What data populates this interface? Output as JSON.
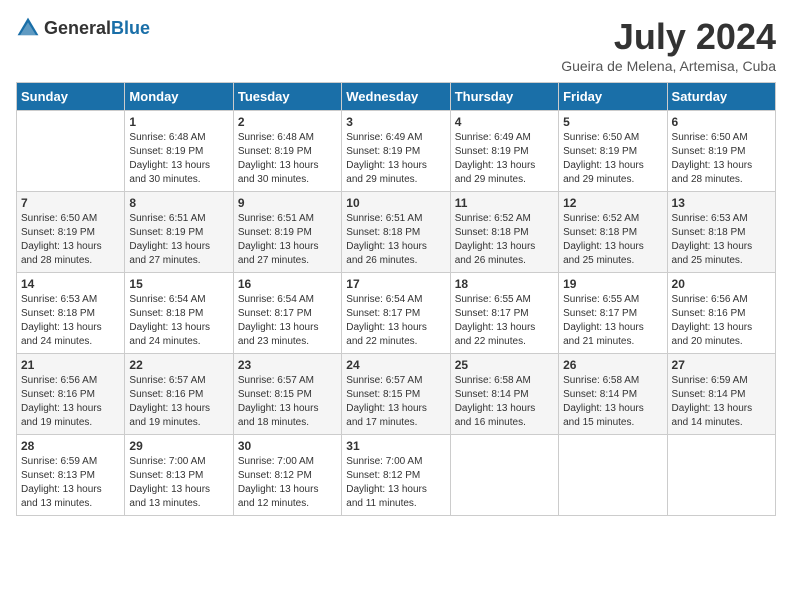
{
  "header": {
    "logo_general": "General",
    "logo_blue": "Blue",
    "month": "July 2024",
    "location": "Gueira de Melena, Artemisa, Cuba"
  },
  "weekdays": [
    "Sunday",
    "Monday",
    "Tuesday",
    "Wednesday",
    "Thursday",
    "Friday",
    "Saturday"
  ],
  "weeks": [
    [
      {
        "day": "",
        "sunrise": "",
        "sunset": "",
        "daylight": ""
      },
      {
        "day": "1",
        "sunrise": "Sunrise: 6:48 AM",
        "sunset": "Sunset: 8:19 PM",
        "daylight": "Daylight: 13 hours and 30 minutes."
      },
      {
        "day": "2",
        "sunrise": "Sunrise: 6:48 AM",
        "sunset": "Sunset: 8:19 PM",
        "daylight": "Daylight: 13 hours and 30 minutes."
      },
      {
        "day": "3",
        "sunrise": "Sunrise: 6:49 AM",
        "sunset": "Sunset: 8:19 PM",
        "daylight": "Daylight: 13 hours and 29 minutes."
      },
      {
        "day": "4",
        "sunrise": "Sunrise: 6:49 AM",
        "sunset": "Sunset: 8:19 PM",
        "daylight": "Daylight: 13 hours and 29 minutes."
      },
      {
        "day": "5",
        "sunrise": "Sunrise: 6:50 AM",
        "sunset": "Sunset: 8:19 PM",
        "daylight": "Daylight: 13 hours and 29 minutes."
      },
      {
        "day": "6",
        "sunrise": "Sunrise: 6:50 AM",
        "sunset": "Sunset: 8:19 PM",
        "daylight": "Daylight: 13 hours and 28 minutes."
      }
    ],
    [
      {
        "day": "7",
        "sunrise": "Sunrise: 6:50 AM",
        "sunset": "Sunset: 8:19 PM",
        "daylight": "Daylight: 13 hours and 28 minutes."
      },
      {
        "day": "8",
        "sunrise": "Sunrise: 6:51 AM",
        "sunset": "Sunset: 8:19 PM",
        "daylight": "Daylight: 13 hours and 27 minutes."
      },
      {
        "day": "9",
        "sunrise": "Sunrise: 6:51 AM",
        "sunset": "Sunset: 8:19 PM",
        "daylight": "Daylight: 13 hours and 27 minutes."
      },
      {
        "day": "10",
        "sunrise": "Sunrise: 6:51 AM",
        "sunset": "Sunset: 8:18 PM",
        "daylight": "Daylight: 13 hours and 26 minutes."
      },
      {
        "day": "11",
        "sunrise": "Sunrise: 6:52 AM",
        "sunset": "Sunset: 8:18 PM",
        "daylight": "Daylight: 13 hours and 26 minutes."
      },
      {
        "day": "12",
        "sunrise": "Sunrise: 6:52 AM",
        "sunset": "Sunset: 8:18 PM",
        "daylight": "Daylight: 13 hours and 25 minutes."
      },
      {
        "day": "13",
        "sunrise": "Sunrise: 6:53 AM",
        "sunset": "Sunset: 8:18 PM",
        "daylight": "Daylight: 13 hours and 25 minutes."
      }
    ],
    [
      {
        "day": "14",
        "sunrise": "Sunrise: 6:53 AM",
        "sunset": "Sunset: 8:18 PM",
        "daylight": "Daylight: 13 hours and 24 minutes."
      },
      {
        "day": "15",
        "sunrise": "Sunrise: 6:54 AM",
        "sunset": "Sunset: 8:18 PM",
        "daylight": "Daylight: 13 hours and 24 minutes."
      },
      {
        "day": "16",
        "sunrise": "Sunrise: 6:54 AM",
        "sunset": "Sunset: 8:17 PM",
        "daylight": "Daylight: 13 hours and 23 minutes."
      },
      {
        "day": "17",
        "sunrise": "Sunrise: 6:54 AM",
        "sunset": "Sunset: 8:17 PM",
        "daylight": "Daylight: 13 hours and 22 minutes."
      },
      {
        "day": "18",
        "sunrise": "Sunrise: 6:55 AM",
        "sunset": "Sunset: 8:17 PM",
        "daylight": "Daylight: 13 hours and 22 minutes."
      },
      {
        "day": "19",
        "sunrise": "Sunrise: 6:55 AM",
        "sunset": "Sunset: 8:17 PM",
        "daylight": "Daylight: 13 hours and 21 minutes."
      },
      {
        "day": "20",
        "sunrise": "Sunrise: 6:56 AM",
        "sunset": "Sunset: 8:16 PM",
        "daylight": "Daylight: 13 hours and 20 minutes."
      }
    ],
    [
      {
        "day": "21",
        "sunrise": "Sunrise: 6:56 AM",
        "sunset": "Sunset: 8:16 PM",
        "daylight": "Daylight: 13 hours and 19 minutes."
      },
      {
        "day": "22",
        "sunrise": "Sunrise: 6:57 AM",
        "sunset": "Sunset: 8:16 PM",
        "daylight": "Daylight: 13 hours and 19 minutes."
      },
      {
        "day": "23",
        "sunrise": "Sunrise: 6:57 AM",
        "sunset": "Sunset: 8:15 PM",
        "daylight": "Daylight: 13 hours and 18 minutes."
      },
      {
        "day": "24",
        "sunrise": "Sunrise: 6:57 AM",
        "sunset": "Sunset: 8:15 PM",
        "daylight": "Daylight: 13 hours and 17 minutes."
      },
      {
        "day": "25",
        "sunrise": "Sunrise: 6:58 AM",
        "sunset": "Sunset: 8:14 PM",
        "daylight": "Daylight: 13 hours and 16 minutes."
      },
      {
        "day": "26",
        "sunrise": "Sunrise: 6:58 AM",
        "sunset": "Sunset: 8:14 PM",
        "daylight": "Daylight: 13 hours and 15 minutes."
      },
      {
        "day": "27",
        "sunrise": "Sunrise: 6:59 AM",
        "sunset": "Sunset: 8:14 PM",
        "daylight": "Daylight: 13 hours and 14 minutes."
      }
    ],
    [
      {
        "day": "28",
        "sunrise": "Sunrise: 6:59 AM",
        "sunset": "Sunset: 8:13 PM",
        "daylight": "Daylight: 13 hours and 13 minutes."
      },
      {
        "day": "29",
        "sunrise": "Sunrise: 7:00 AM",
        "sunset": "Sunset: 8:13 PM",
        "daylight": "Daylight: 13 hours and 13 minutes."
      },
      {
        "day": "30",
        "sunrise": "Sunrise: 7:00 AM",
        "sunset": "Sunset: 8:12 PM",
        "daylight": "Daylight: 13 hours and 12 minutes."
      },
      {
        "day": "31",
        "sunrise": "Sunrise: 7:00 AM",
        "sunset": "Sunset: 8:12 PM",
        "daylight": "Daylight: 13 hours and 11 minutes."
      },
      {
        "day": "",
        "sunrise": "",
        "sunset": "",
        "daylight": ""
      },
      {
        "day": "",
        "sunrise": "",
        "sunset": "",
        "daylight": ""
      },
      {
        "day": "",
        "sunrise": "",
        "sunset": "",
        "daylight": ""
      }
    ]
  ]
}
